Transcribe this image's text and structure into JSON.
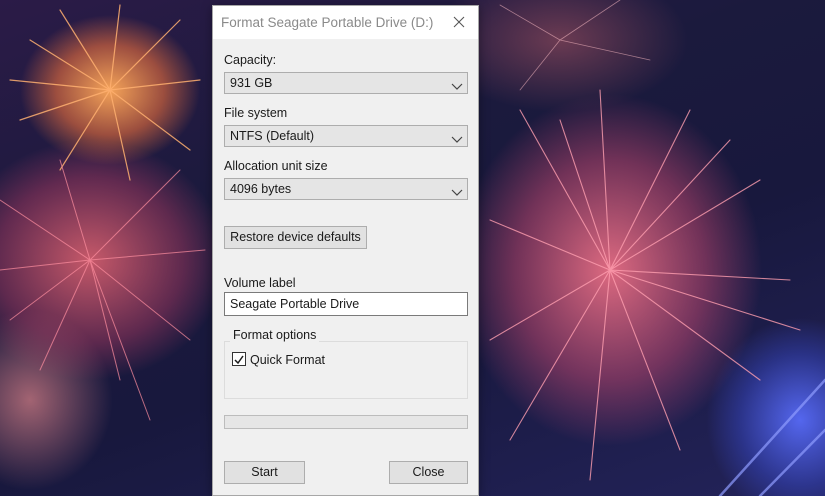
{
  "dialog": {
    "title": "Format Seagate Portable Drive (D:)",
    "capacity": {
      "label": "Capacity:",
      "value": "931 GB"
    },
    "file_system": {
      "label": "File system",
      "value": "NTFS (Default)"
    },
    "allocation": {
      "label": "Allocation unit size",
      "value": "4096 bytes"
    },
    "restore_label": "Restore device defaults",
    "volume": {
      "label": "Volume label",
      "value": "Seagate Portable Drive"
    },
    "format_options": {
      "title": "Format options",
      "quick_format_label": "Quick Format",
      "quick_format_checked": true
    },
    "progress_fraction": 0,
    "start_label": "Start",
    "close_label": "Close"
  },
  "colors": {
    "dialog_bg": "#f0f0f0",
    "titlebar_bg": "#ffffff",
    "title_text": "#8a8a8a",
    "progress_fill": "#06b025"
  },
  "icons": {
    "close": "close-icon",
    "dropdown": "chevron-down-icon",
    "checkbox": "check-icon"
  }
}
